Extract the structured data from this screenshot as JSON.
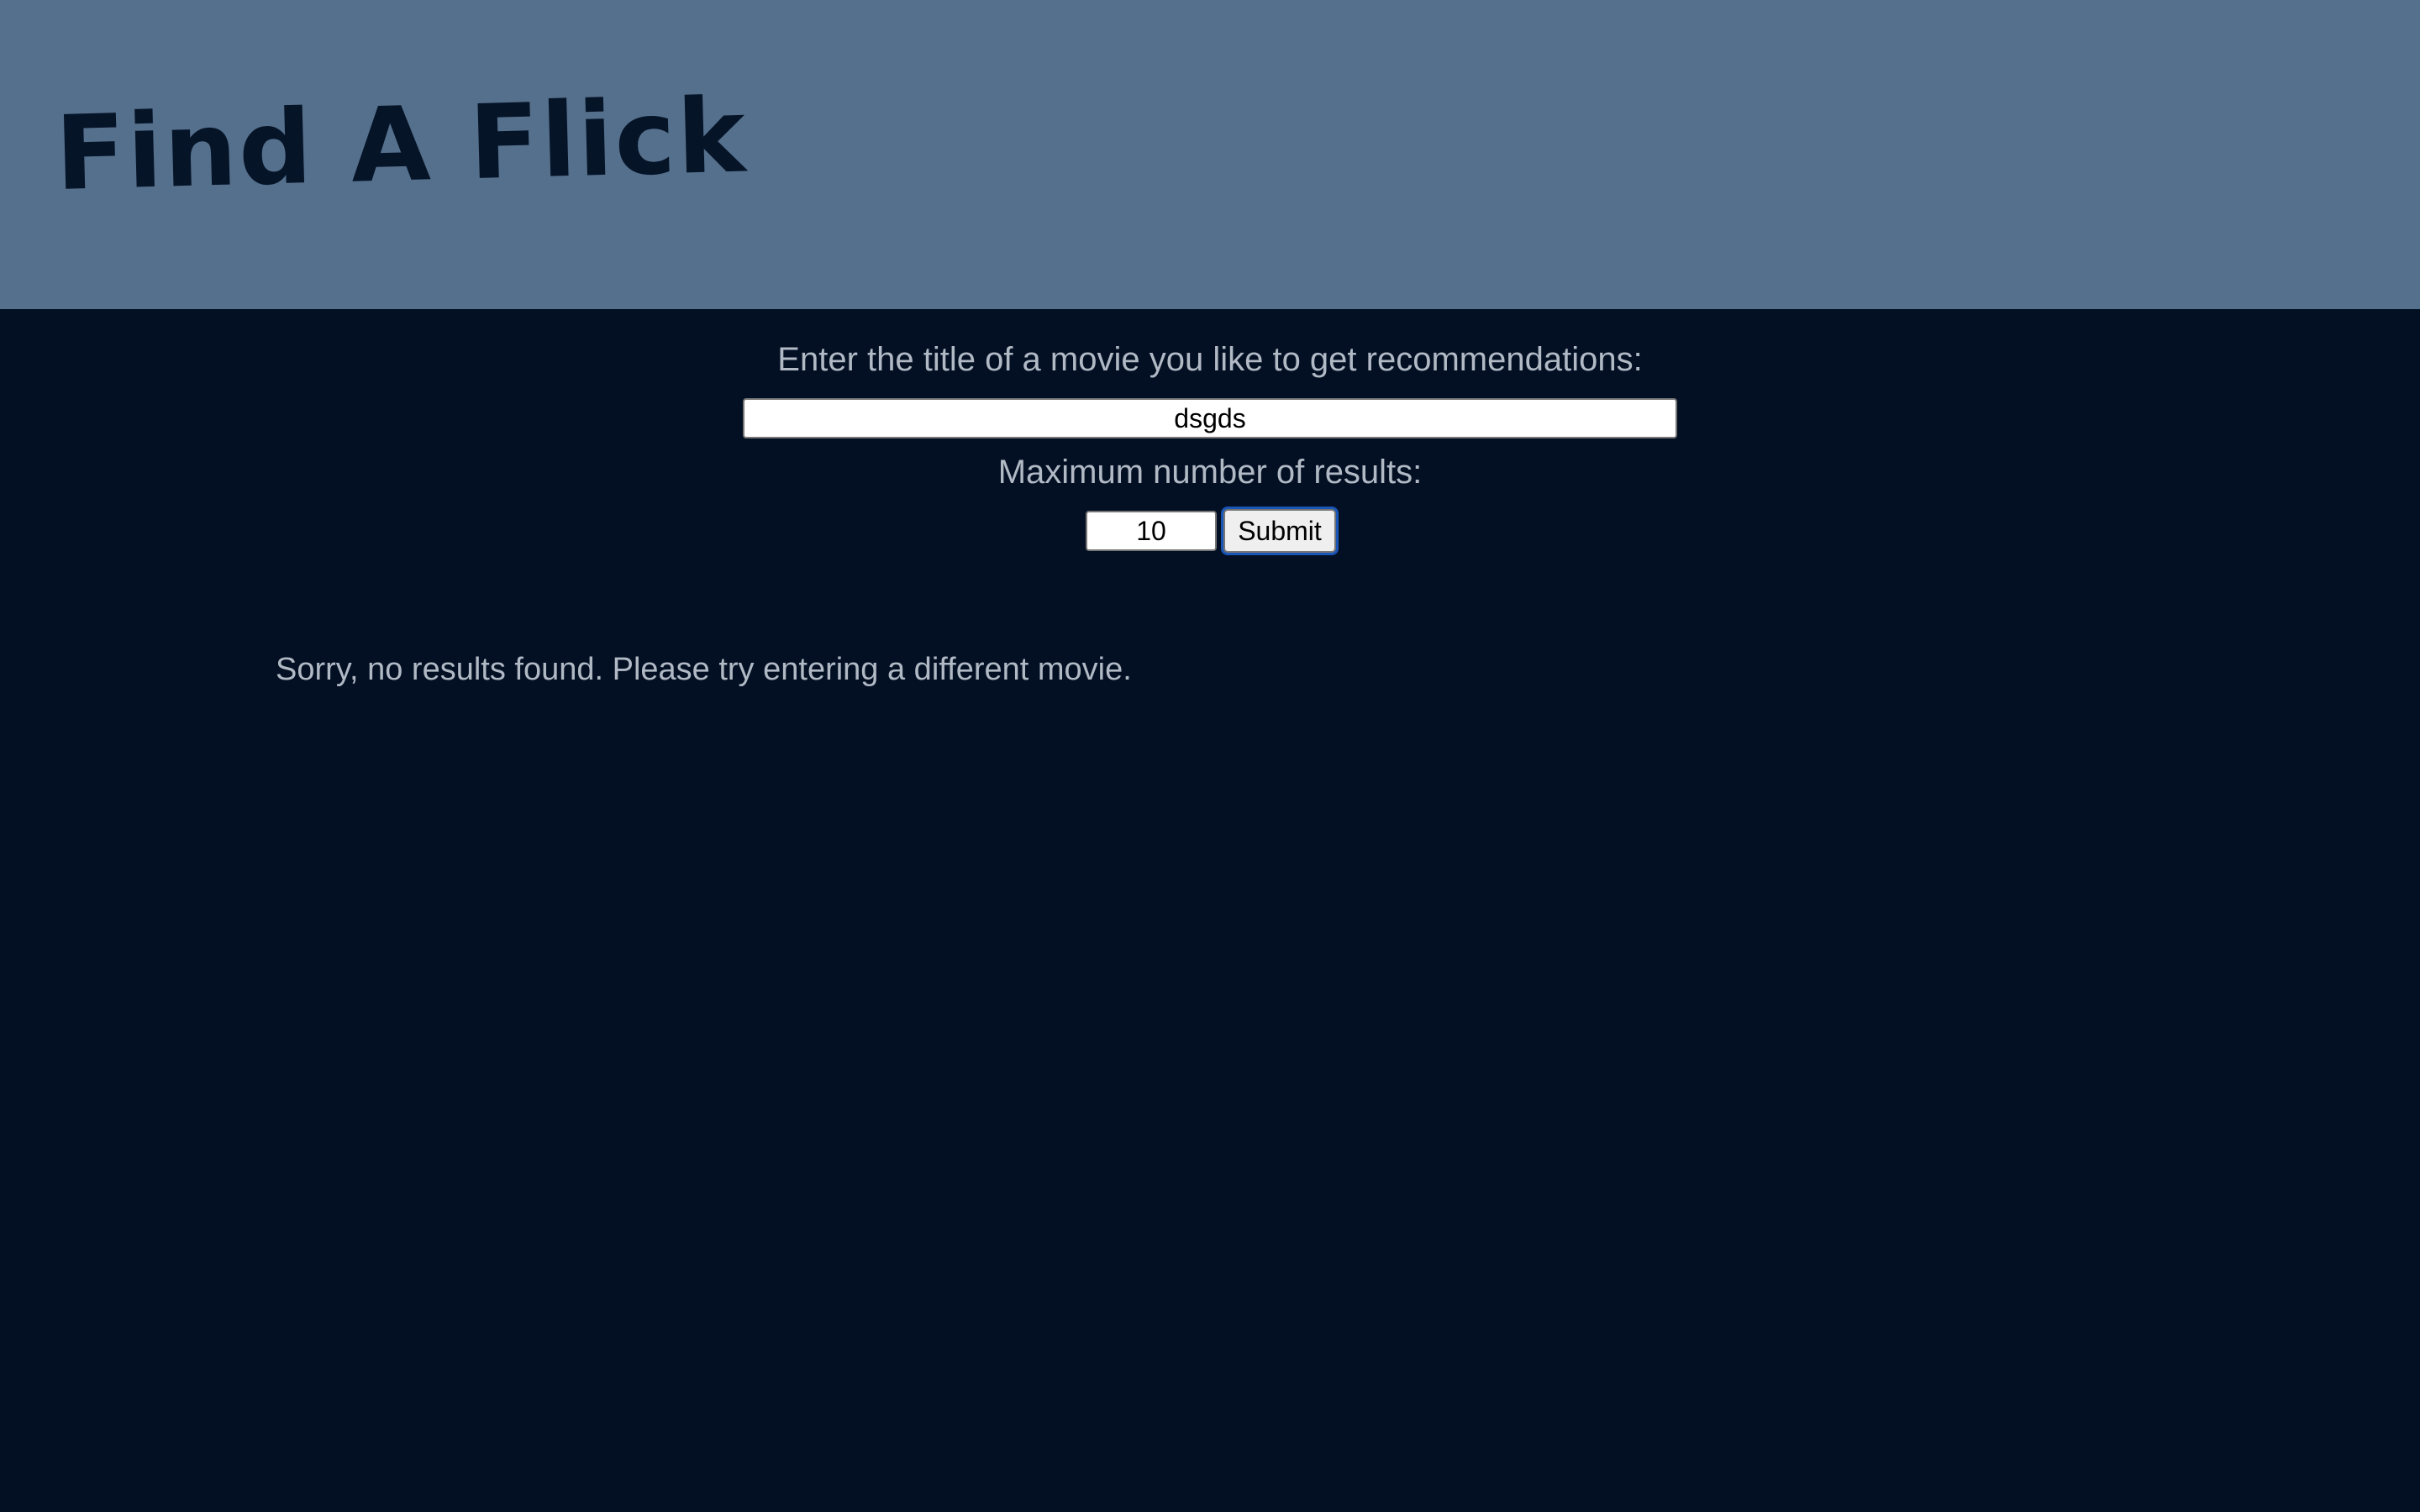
{
  "header": {
    "logo_text": "Find A Flick"
  },
  "form": {
    "title_label": "Enter the title of a movie you like to get recommendations:",
    "title_value": "dsgds",
    "max_label": "Maximum number of results:",
    "max_value": "10",
    "submit_label": "Submit"
  },
  "results": {
    "message": "Sorry, no results found. Please try entering a different movie."
  },
  "colors": {
    "header_bg": "#55708c",
    "page_bg": "#031024",
    "logo": "#061428",
    "label_text": "#b0b9c4",
    "focus_ring": "#1a56b6"
  }
}
